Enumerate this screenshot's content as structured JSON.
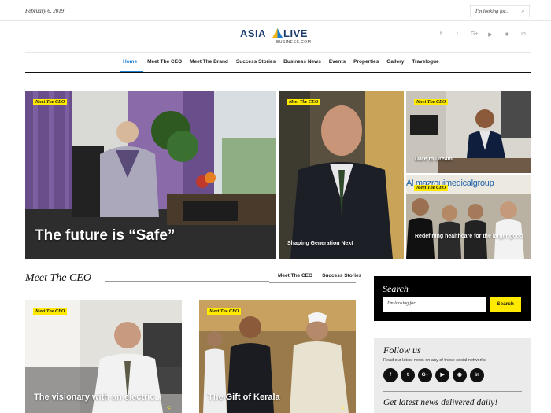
{
  "topbar": {
    "date": "February 6, 2019",
    "search_placeholder": "I'm looking for...",
    "search_icon": "search-icon"
  },
  "logo": {
    "word_left": "ASIA",
    "word_right": "LIVE",
    "sub": "BUSINESS.COM"
  },
  "social_top": [
    "f",
    "t",
    "G+",
    "▶",
    "rss",
    "in"
  ],
  "nav": {
    "items": [
      {
        "label": "Home",
        "active": true
      },
      {
        "label": "Meet The CEO"
      },
      {
        "label": "Meet The Brand"
      },
      {
        "label": "Success Stories"
      },
      {
        "label": "Business News"
      },
      {
        "label": "Events"
      },
      {
        "label": "Properties"
      },
      {
        "label": "Gallery"
      },
      {
        "label": "Travelogue"
      }
    ]
  },
  "hero": {
    "main": {
      "tag": "Meet The CEO",
      "title": "The future is “Safe”"
    },
    "mid": {
      "tag": "Meet The CEO",
      "title": "Shaping Generation Next"
    },
    "right_top": {
      "tag": "Meet The CEO",
      "title": "Dare to Dream"
    },
    "right_bottom": {
      "tag": "Meet The CEO",
      "title": "Redefining healthcare for the larger good",
      "sign": "Al mazrouimedicalgroup"
    }
  },
  "section": {
    "heading": "Meet The CEO",
    "tabs": [
      "Meet The CEO",
      "Success Stories"
    ]
  },
  "cards": [
    {
      "tag": "Meet The CEO",
      "title": "The visionary with an electric..."
    },
    {
      "tag": "Meet The CEO",
      "title": "The Gift of Kerala"
    }
  ],
  "sidebar": {
    "search": {
      "heading": "Search",
      "placeholder": "I'm looking for...",
      "button": "Search"
    },
    "follow": {
      "heading": "Follow us",
      "text": "Read our latest news on any of these social networks!",
      "icons": [
        "f",
        "t",
        "G+",
        "▶",
        "rss",
        "in"
      ],
      "subscribe_heading": "Get latest news delivered daily!"
    }
  },
  "colors": {
    "accent_yellow": "#ffea00",
    "nav_active": "#1b7fd1",
    "brand_navy": "#1b3d6d",
    "brand_gold": "#f3b51a"
  }
}
